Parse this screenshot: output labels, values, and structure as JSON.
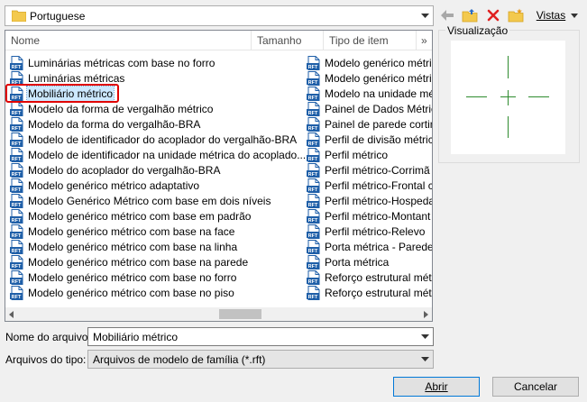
{
  "path": {
    "label": "Portuguese"
  },
  "toolbar": {
    "views_label": "Vistas"
  },
  "columns": {
    "name": "Nome",
    "size": "Tamanho",
    "type": "Tipo de item",
    "more": "»"
  },
  "files_col1": [
    "Luminárias métricas com base no forro",
    "Luminárias métricas",
    "Mobiliário métrico",
    "Modelo da forma de vergalhão métrico",
    "Modelo da forma do vergalhão-BRA",
    "Modelo de identificador do acoplador do vergalhão-BRA",
    "Modelo de identificador na unidade métrica do acoplado...",
    "Modelo do acoplador do vergalhão-BRA",
    "Modelo genérico métrico adaptativo",
    "Modelo Genérico Métrico com base em dois níveis",
    "Modelo genérico métrico com base em padrão",
    "Modelo genérico métrico com base na face",
    "Modelo genérico métrico com base na linha",
    "Modelo genérico métrico com base na parede",
    "Modelo genérico métrico com base no forro",
    "Modelo genérico métrico com base no piso"
  ],
  "files_col2": [
    "Modelo genérico métri",
    "Modelo genérico métri",
    "Modelo na unidade mé",
    "Painel de Dados Métric",
    "Painel de parede cortin",
    "Perfil de divisão métric",
    "Perfil métrico",
    "Perfil métrico-Corrimã",
    "Perfil métrico-Frontal c",
    "Perfil métrico-Hospeda",
    "Perfil métrico-Montant",
    "Perfil métrico-Relevo",
    "Porta métrica - Parede",
    "Porta métrica",
    "Reforço estrutural métr",
    "Reforço estrutural métr"
  ],
  "selected_index": 2,
  "icon_label": "RFT",
  "preview": {
    "label": "Visualização"
  },
  "file_name": {
    "label": "Nome do arquivo:",
    "value": "Mobiliário métrico"
  },
  "file_type": {
    "label": "Arquivos do tipo:",
    "value": "Arquivos de modelo de família  (*.rft)"
  },
  "buttons": {
    "open": "Abrir",
    "cancel": "Cancelar"
  },
  "colors": {
    "accent": "#0078d7",
    "selection": "#cce8ff",
    "highlight": "#e00000",
    "crosshair": "#2e8b2e"
  }
}
